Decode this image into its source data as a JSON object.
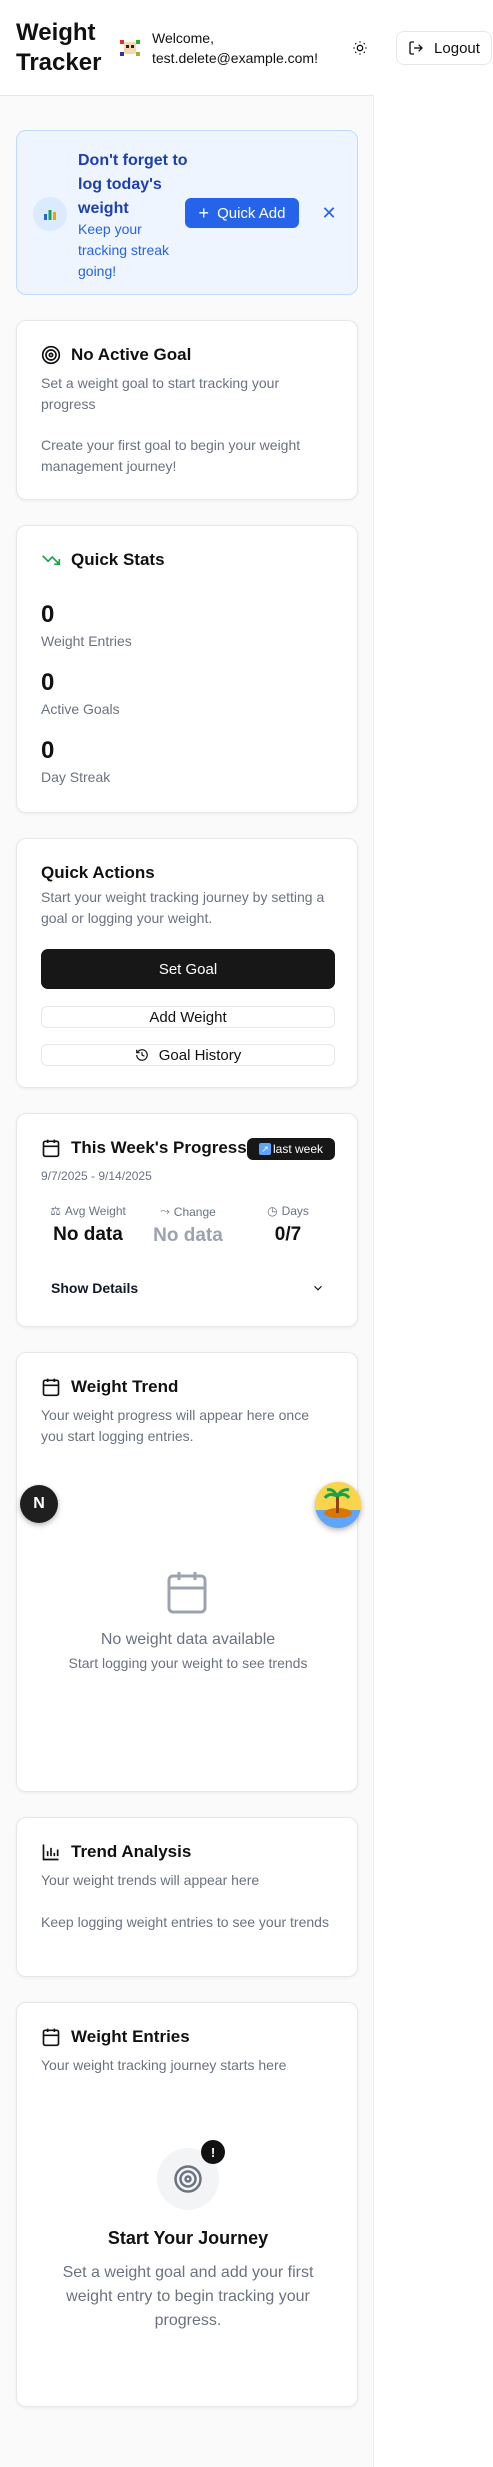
{
  "header": {
    "brand": "Weight Tracker",
    "welcome": "Welcome, test.delete@example.com!",
    "logout_label": "Logout"
  },
  "reminder": {
    "title": "Don't forget to log today's weight",
    "subtitle": "Keep your tracking streak going!",
    "quick_add_label": "Quick Add"
  },
  "no_goal": {
    "title": "No Active Goal",
    "subtitle": "Set a weight goal to start tracking your progress",
    "body": "Create your first goal to begin your weight management journey!"
  },
  "quick_stats": {
    "title": "Quick Stats",
    "stats": [
      {
        "value": "0",
        "label": "Weight Entries"
      },
      {
        "value": "0",
        "label": "Active Goals"
      },
      {
        "value": "0",
        "label": "Day Streak"
      }
    ]
  },
  "quick_actions": {
    "title": "Quick Actions",
    "subtitle": "Start your weight tracking journey by setting a goal or logging your weight.",
    "set_goal": "Set Goal",
    "add_weight": "Add Weight",
    "goal_history": "Goal History"
  },
  "weekly": {
    "title": "This Week's Progress",
    "badge": "last week",
    "date_range": "9/7/2025 - 9/14/2025",
    "columns": [
      {
        "label": "Avg Weight",
        "value": "No data"
      },
      {
        "label": "Change",
        "value": "No data"
      },
      {
        "label": "Days",
        "value": "0/7"
      }
    ],
    "show_details": "Show Details"
  },
  "trend": {
    "title": "Weight Trend",
    "subtitle": "Your weight progress will appear here once you start logging entries.",
    "empty_title": "No weight data available",
    "empty_sub": "Start logging your weight to see trends"
  },
  "analysis": {
    "title": "Trend Analysis",
    "subtitle": "Your weight trends will appear here",
    "body": "Keep logging weight entries to see your trends"
  },
  "entries": {
    "title": "Weight Entries",
    "subtitle": "Your weight tracking journey starts here",
    "badge": "!",
    "journey_title": "Start Your Journey",
    "journey_body": "Set a weight goal and add your first weight entry to begin tracking your progress."
  },
  "floating": {
    "n_label": "N"
  },
  "colors": {
    "accent": "#2563eb",
    "reminder_bg": "#eef5ff",
    "dark_button": "#171717",
    "trend_green": "#16a34a"
  }
}
